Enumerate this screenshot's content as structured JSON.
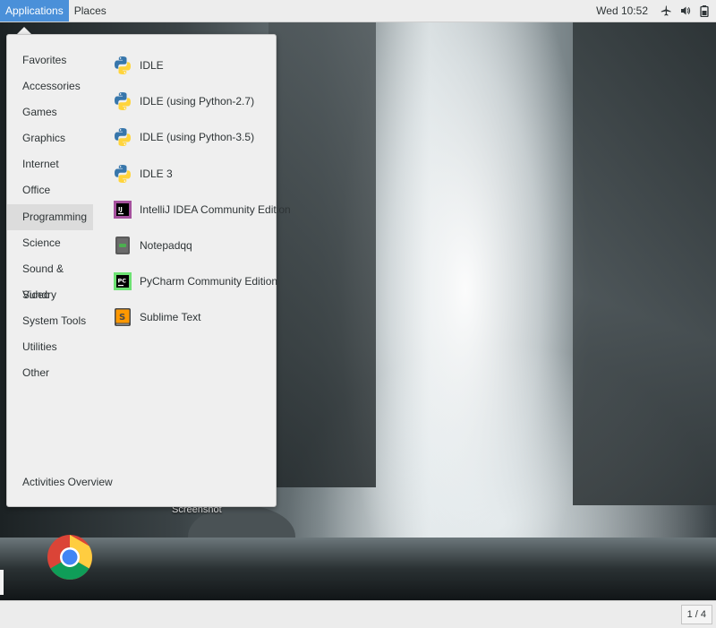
{
  "topbar": {
    "applications_label": "Applications",
    "places_label": "Places",
    "clock": "Wed 10:52",
    "tray_icons": [
      "airplane-mode-icon",
      "volume-muted-icon",
      "battery-icon"
    ]
  },
  "menu": {
    "categories": [
      {
        "label": "Favorites"
      },
      {
        "label": "Accessories"
      },
      {
        "label": "Games"
      },
      {
        "label": "Graphics"
      },
      {
        "label": "Internet"
      },
      {
        "label": "Office"
      },
      {
        "label": "Programming",
        "selected": true
      },
      {
        "label": "Science"
      },
      {
        "label": "Sound & Video"
      },
      {
        "label": "Sundry"
      },
      {
        "label": "System Tools"
      },
      {
        "label": "Utilities"
      },
      {
        "label": "Other"
      }
    ],
    "activities_label": "Activities Overview",
    "apps": [
      {
        "label": "IDLE",
        "icon": "python-icon"
      },
      {
        "label": "IDLE (using Python-2.7)",
        "icon": "python-icon"
      },
      {
        "label": "IDLE (using Python-3.5)",
        "icon": "python-icon"
      },
      {
        "label": "IDLE 3",
        "icon": "python-icon"
      },
      {
        "label": "IntelliJ IDEA Community Edition",
        "icon": "intellij-icon"
      },
      {
        "label": "Notepadqq",
        "icon": "notepadqq-icon"
      },
      {
        "label": "PyCharm Community Edition",
        "icon": "pycharm-icon"
      },
      {
        "label": "Sublime Text",
        "icon": "sublime-icon"
      }
    ]
  },
  "desktop": {
    "icon_label": "Screenshot",
    "dock_icon": "chrome-icon"
  },
  "bottombar": {
    "workspace": "1 / 4"
  },
  "colors": {
    "accent": "#4a90d9",
    "menu_bg": "#efefef",
    "selected_bg": "#dcdcdc"
  }
}
